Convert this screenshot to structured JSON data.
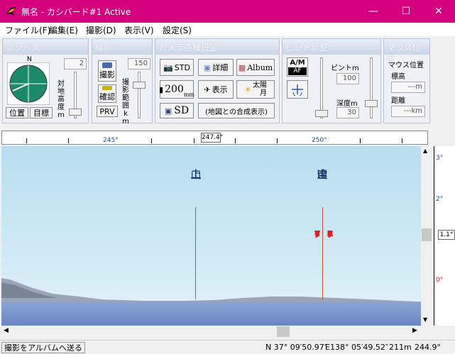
{
  "window": {
    "title": "無名 - カシバード#1 Active",
    "min_label": "—",
    "max_label": "☐",
    "close_label": "✕",
    "accent": "#d4007d"
  },
  "menu": {
    "file": "ファイル(F)",
    "edit": "編集(E)",
    "shoot": "撮影(D)",
    "view": "表示(V)",
    "settings": "設定(S)"
  },
  "compass": {
    "title": "コンパス",
    "north": "N",
    "btn_position": "位置",
    "btn_target": "目標",
    "height_label": "対地高度m",
    "height_value": "2"
  },
  "shoot": {
    "title": "撮影",
    "btn_shoot": "撮影",
    "btn_confirm": "確認",
    "btn_prv": "PRV",
    "range_label": "撮影範囲km",
    "range_value": "150"
  },
  "camera": {
    "title": "カメラ各種設定",
    "btn_std": "STD",
    "btn_detail": "詳細",
    "btn_album": "Album",
    "btn_200": "200",
    "btn_200_unit": "mm",
    "btn_display": "表示",
    "btn_sun_moon_top": "太陽",
    "btn_sun_moon_bottom": "月",
    "btn_sd": "SD",
    "btn_composite": "(地図との合成表示)"
  },
  "focus": {
    "title": "ピント調整",
    "am_label": "A/M",
    "af_label": "AF",
    "pinto_label": "ピントm",
    "pinto_value": "100",
    "depth_label": "深度m",
    "depth_value": "30"
  },
  "mouse": {
    "title": "マウス位置",
    "elev_label": "標高",
    "elev_value": "---m",
    "dist_label": "距離",
    "dist_value": "---km"
  },
  "ruler": {
    "left_label": "245°",
    "right_label": "250°",
    "readout": "247.4°"
  },
  "scene": {
    "peak1_name": [
      "二",
      "上",
      "山"
    ],
    "peak2_name": [
      "宝",
      "達",
      "山"
    ],
    "callsign1": [
      "J",
      "E",
      "0",
      "V",
      "I",
      "L"
    ],
    "callsign2": [
      "J",
      "A",
      "0",
      "R",
      "U",
      "Z"
    ]
  },
  "vscale": {
    "l3": "3°",
    "l2": "2°",
    "l1": "1.1°",
    "l0": "0°"
  },
  "status": {
    "hint": "撮影をアルバムへ送る",
    "lat": "N 37° 09′50.97″",
    "lon": "E138° 05′49.52″",
    "elev": "211m",
    "bearing": "244.9°"
  }
}
